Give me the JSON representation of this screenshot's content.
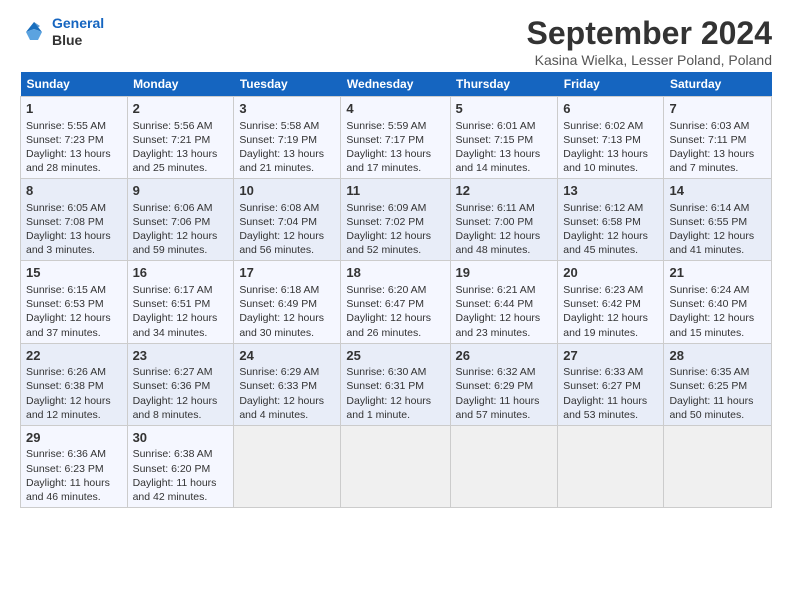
{
  "header": {
    "logo_line1": "General",
    "logo_line2": "Blue",
    "month": "September 2024",
    "location": "Kasina Wielka, Lesser Poland, Poland"
  },
  "weekdays": [
    "Sunday",
    "Monday",
    "Tuesday",
    "Wednesday",
    "Thursday",
    "Friday",
    "Saturday"
  ],
  "weeks": [
    [
      {
        "day": "1",
        "sunrise": "5:55 AM",
        "sunset": "7:23 PM",
        "daylight": "13 hours and 28 minutes."
      },
      {
        "day": "2",
        "sunrise": "5:56 AM",
        "sunset": "7:21 PM",
        "daylight": "13 hours and 25 minutes."
      },
      {
        "day": "3",
        "sunrise": "5:58 AM",
        "sunset": "7:19 PM",
        "daylight": "13 hours and 21 minutes."
      },
      {
        "day": "4",
        "sunrise": "5:59 AM",
        "sunset": "7:17 PM",
        "daylight": "13 hours and 17 minutes."
      },
      {
        "day": "5",
        "sunrise": "6:01 AM",
        "sunset": "7:15 PM",
        "daylight": "13 hours and 14 minutes."
      },
      {
        "day": "6",
        "sunrise": "6:02 AM",
        "sunset": "7:13 PM",
        "daylight": "13 hours and 10 minutes."
      },
      {
        "day": "7",
        "sunrise": "6:03 AM",
        "sunset": "7:11 PM",
        "daylight": "13 hours and 7 minutes."
      }
    ],
    [
      {
        "day": "8",
        "sunrise": "6:05 AM",
        "sunset": "7:08 PM",
        "daylight": "13 hours and 3 minutes."
      },
      {
        "day": "9",
        "sunrise": "6:06 AM",
        "sunset": "7:06 PM",
        "daylight": "12 hours and 59 minutes."
      },
      {
        "day": "10",
        "sunrise": "6:08 AM",
        "sunset": "7:04 PM",
        "daylight": "12 hours and 56 minutes."
      },
      {
        "day": "11",
        "sunrise": "6:09 AM",
        "sunset": "7:02 PM",
        "daylight": "12 hours and 52 minutes."
      },
      {
        "day": "12",
        "sunrise": "6:11 AM",
        "sunset": "7:00 PM",
        "daylight": "12 hours and 48 minutes."
      },
      {
        "day": "13",
        "sunrise": "6:12 AM",
        "sunset": "6:58 PM",
        "daylight": "12 hours and 45 minutes."
      },
      {
        "day": "14",
        "sunrise": "6:14 AM",
        "sunset": "6:55 PM",
        "daylight": "12 hours and 41 minutes."
      }
    ],
    [
      {
        "day": "15",
        "sunrise": "6:15 AM",
        "sunset": "6:53 PM",
        "daylight": "12 hours and 37 minutes."
      },
      {
        "day": "16",
        "sunrise": "6:17 AM",
        "sunset": "6:51 PM",
        "daylight": "12 hours and 34 minutes."
      },
      {
        "day": "17",
        "sunrise": "6:18 AM",
        "sunset": "6:49 PM",
        "daylight": "12 hours and 30 minutes."
      },
      {
        "day": "18",
        "sunrise": "6:20 AM",
        "sunset": "6:47 PM",
        "daylight": "12 hours and 26 minutes."
      },
      {
        "day": "19",
        "sunrise": "6:21 AM",
        "sunset": "6:44 PM",
        "daylight": "12 hours and 23 minutes."
      },
      {
        "day": "20",
        "sunrise": "6:23 AM",
        "sunset": "6:42 PM",
        "daylight": "12 hours and 19 minutes."
      },
      {
        "day": "21",
        "sunrise": "6:24 AM",
        "sunset": "6:40 PM",
        "daylight": "12 hours and 15 minutes."
      }
    ],
    [
      {
        "day": "22",
        "sunrise": "6:26 AM",
        "sunset": "6:38 PM",
        "daylight": "12 hours and 12 minutes."
      },
      {
        "day": "23",
        "sunrise": "6:27 AM",
        "sunset": "6:36 PM",
        "daylight": "12 hours and 8 minutes."
      },
      {
        "day": "24",
        "sunrise": "6:29 AM",
        "sunset": "6:33 PM",
        "daylight": "12 hours and 4 minutes."
      },
      {
        "day": "25",
        "sunrise": "6:30 AM",
        "sunset": "6:31 PM",
        "daylight": "12 hours and 1 minute."
      },
      {
        "day": "26",
        "sunrise": "6:32 AM",
        "sunset": "6:29 PM",
        "daylight": "11 hours and 57 minutes."
      },
      {
        "day": "27",
        "sunrise": "6:33 AM",
        "sunset": "6:27 PM",
        "daylight": "11 hours and 53 minutes."
      },
      {
        "day": "28",
        "sunrise": "6:35 AM",
        "sunset": "6:25 PM",
        "daylight": "11 hours and 50 minutes."
      }
    ],
    [
      {
        "day": "29",
        "sunrise": "6:36 AM",
        "sunset": "6:23 PM",
        "daylight": "11 hours and 46 minutes."
      },
      {
        "day": "30",
        "sunrise": "6:38 AM",
        "sunset": "6:20 PM",
        "daylight": "11 hours and 42 minutes."
      },
      null,
      null,
      null,
      null,
      null
    ]
  ],
  "labels": {
    "sunrise": "Sunrise:",
    "sunset": "Sunset:",
    "daylight": "Daylight:"
  }
}
